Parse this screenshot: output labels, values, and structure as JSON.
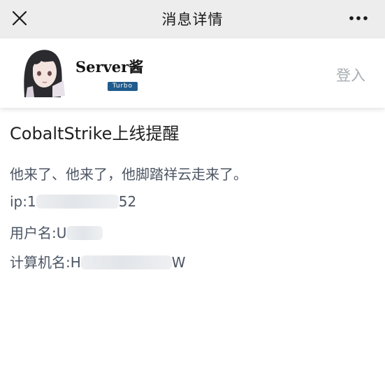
{
  "nav": {
    "title": "消息详情",
    "close_icon": "close-icon",
    "more_icon": "more-horizontal-icon"
  },
  "profile": {
    "name": "Server酱",
    "badge": "Turbo",
    "login_label": "登入"
  },
  "message": {
    "title": "CobaltStrike上线提醒",
    "body_line": "他来了、他来了，他脚踏祥云走来了。",
    "ip_prefix": "ip:1",
    "ip_suffix": "52",
    "username_prefix": "用户名:U",
    "computer_prefix": "计算机名:H",
    "computer_suffix": "W"
  },
  "colors": {
    "nav_bg": "#ededed",
    "badge_bg": "#1f5b8c",
    "login_text": "#a7adb2",
    "body_text": "#4b5563"
  }
}
